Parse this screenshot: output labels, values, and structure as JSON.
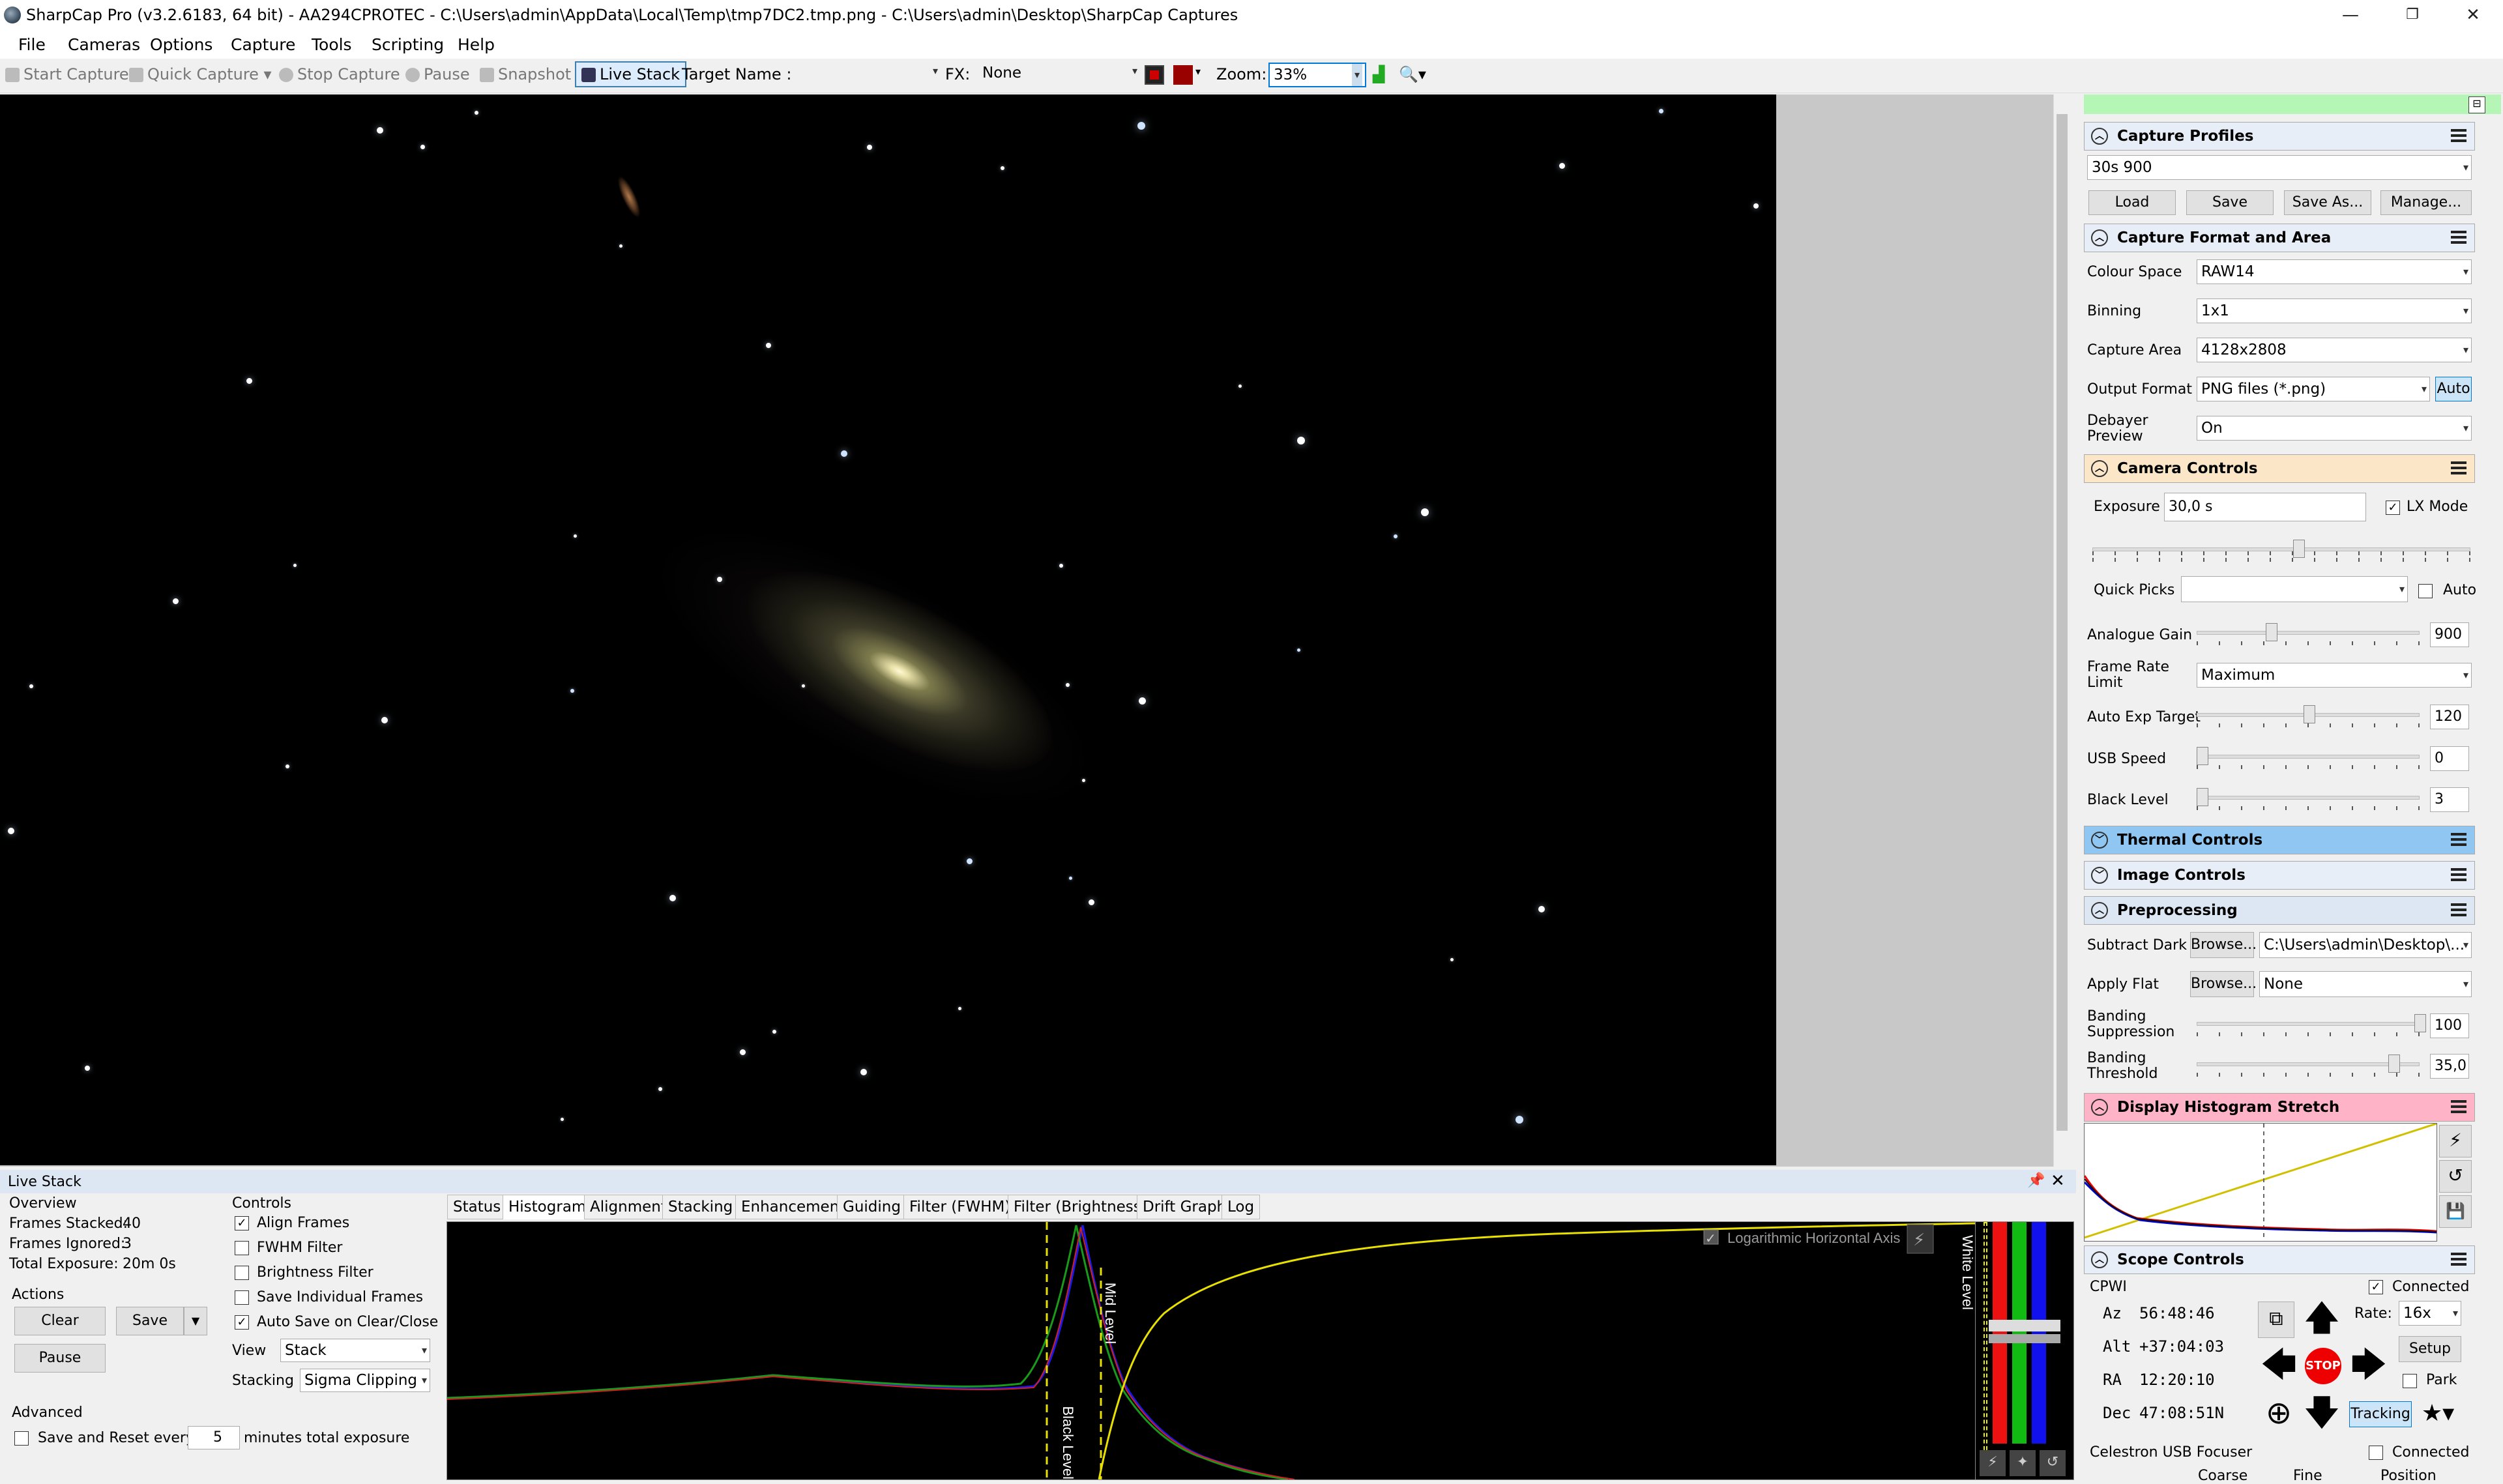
{
  "window": {
    "title": "SharpCap Pro (v3.2.6183, 64 bit) - AA294CPROTEC - C:\\Users\\admin\\AppData\\Local\\Temp\\tmp7DC2.tmp.png - C:\\Users\\admin\\Desktop\\SharpCap Captures",
    "minimize": "—",
    "maximize": "❐",
    "close": "✕"
  },
  "menu": [
    "File",
    "Cameras",
    "Options",
    "Capture",
    "Tools",
    "Scripting",
    "Help"
  ],
  "toolbar": {
    "start_capture": "Start Capture",
    "quick_capture": "Quick Capture",
    "stop_capture": "Stop Capture",
    "pause": "Pause",
    "snapshot": "Snapshot",
    "live_stack": "Live Stack",
    "target_name_label": "Target Name :",
    "target_name_value": "",
    "fx_label": "FX:",
    "fx_value": "None",
    "zoom_label": "Zoom:",
    "zoom_value": "33%"
  },
  "right_panel": {
    "capture_profiles": {
      "title": "Capture Profiles",
      "selected": "30s 900",
      "buttons": [
        "Load",
        "Save",
        "Save As...",
        "Manage..."
      ]
    },
    "capture_format": {
      "title": "Capture Format and Area",
      "colour_space_label": "Colour Space",
      "colour_space": "RAW14",
      "binning_label": "Binning",
      "binning": "1x1",
      "capture_area_label": "Capture Area",
      "capture_area": "4128x2808",
      "output_format_label": "Output Format",
      "output_format": "PNG files (*.png)",
      "auto": "Auto",
      "debayer_label_1": "Debayer",
      "debayer_label_2": "Preview",
      "debayer": "On"
    },
    "camera_controls": {
      "title": "Camera Controls",
      "exposure_label": "Exposure",
      "exposure": "30,0 s",
      "lx_mode": "LX Mode",
      "quick_picks_label": "Quick Picks",
      "quick_picks_auto": "Auto",
      "analogue_gain_label": "Analogue Gain",
      "analogue_gain": "900",
      "frame_rate_label_1": "Frame Rate",
      "frame_rate_label_2": "Limit",
      "frame_rate": "Maximum",
      "auto_exp_label": "Auto Exp Target",
      "auto_exp": "120",
      "usb_speed_label": "USB Speed",
      "usb_speed": "0",
      "black_level_label": "Black Level",
      "black_level": "3"
    },
    "thermal_controls": {
      "title": "Thermal Controls"
    },
    "image_controls": {
      "title": "Image Controls"
    },
    "preprocessing": {
      "title": "Preprocessing",
      "subtract_dark_label": "Subtract Dark",
      "browse": "Browse...",
      "subtract_dark": "C:\\Users\\admin\\Desktop\\...",
      "apply_flat_label": "Apply Flat",
      "apply_flat": "None",
      "banding_supp_label_1": "Banding",
      "banding_supp_label_2": "Suppression",
      "banding_supp": "100",
      "banding_thr_label_1": "Banding",
      "banding_thr_label_2": "Threshold",
      "banding_thr": "35,0"
    },
    "display_histogram": {
      "title": "Display Histogram Stretch"
    },
    "scope_controls": {
      "title": "Scope Controls",
      "mount": "CPWI",
      "connected": "Connected",
      "az_label": "Az",
      "az": "56:48:46",
      "alt_label": "Alt",
      "alt": "+37:04:03",
      "ra_label": "RA",
      "ra": "12:20:10",
      "dec_label": "Dec",
      "dec": "47:08:51N",
      "rate_label": "Rate:",
      "rate": "16x",
      "setup": "Setup",
      "park": "Park",
      "tracking": "Tracking",
      "stop": "STOP"
    },
    "focuser": {
      "name": "Celestron USB Focuser",
      "connected": "Connected",
      "coarse": "Coarse",
      "fine": "Fine",
      "position": "Position"
    }
  },
  "live_stack": {
    "title": "Live Stack",
    "overview_label": "Overview",
    "frames_stacked_label": "Frames Stacked:",
    "frames_stacked": "40",
    "frames_ignored_label": "Frames Ignored:",
    "frames_ignored": "3",
    "total_exposure_label": "Total Exposure:",
    "total_exposure": "20m 0s",
    "actions_label": "Actions",
    "clear": "Clear",
    "save": "Save",
    "pause": "Pause",
    "advanced_label": "Advanced",
    "save_reset_label": "Save and Reset every",
    "save_reset_value": "5",
    "save_reset_suffix": "minutes total exposure",
    "controls_label": "Controls",
    "align_frames": "Align Frames",
    "fwhm_filter": "FWHM Filter",
    "brightness_filter": "Brightness Filter",
    "save_individual": "Save Individual Frames",
    "auto_save": "Auto Save on Clear/Close",
    "view_label": "View",
    "view": "Stack",
    "stacking_label": "Stacking",
    "stacking": "Sigma Clipping",
    "tabs": [
      "Status",
      "Histogram",
      "Alignment",
      "Stacking",
      "Enhancement",
      "Guiding",
      "Filter (FWHM)",
      "Filter (Brightness)",
      "Drift Graph",
      "Log"
    ],
    "active_tab": "Histogram",
    "log_axis_label": "Logarithmic Horizontal Axis",
    "black_level_label": "Black Level",
    "mid_level_label": "Mid Level",
    "white_level_label": "White Level"
  },
  "colors": {
    "accent": "#0078d7",
    "thermal": "#8fc7f2",
    "camera": "#fce6c8",
    "histogram": "#ffb3c6",
    "preproc": "#dde6f3",
    "green_top": "#b5f5b5"
  }
}
